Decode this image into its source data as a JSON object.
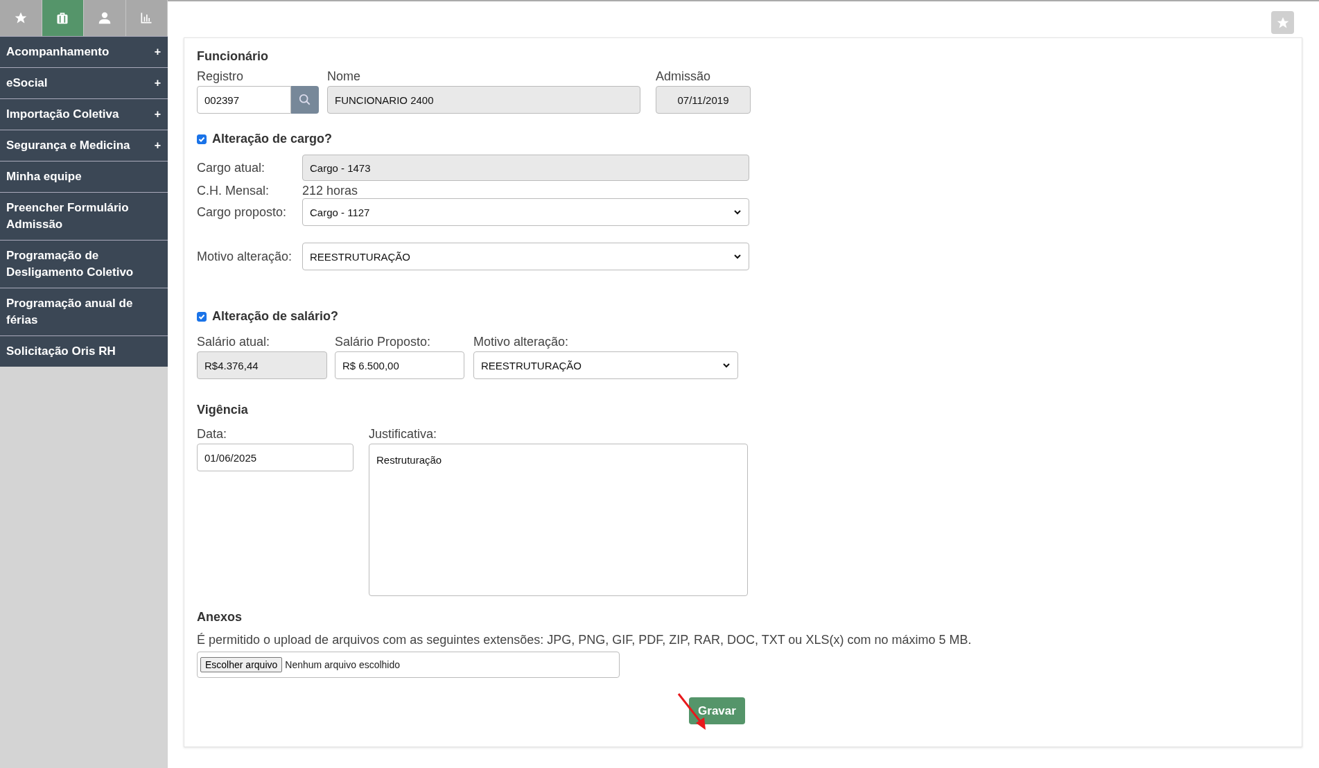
{
  "sidebar": {
    "tabs": [
      {
        "kind": "star",
        "selected": false
      },
      {
        "kind": "briefcase",
        "selected": true
      },
      {
        "kind": "person",
        "selected": false
      },
      {
        "kind": "chart",
        "selected": false
      }
    ],
    "menu": [
      {
        "label": "Acompanhamento",
        "toggle": "+"
      },
      {
        "label": "eSocial",
        "toggle": "+"
      },
      {
        "label": "Importação Coletiva",
        "toggle": "+"
      },
      {
        "label": "Segurança e Medicina",
        "toggle": "+"
      },
      {
        "label": "Minha equipe"
      },
      {
        "label": "Preencher Formulário Admissão"
      },
      {
        "label": "Programação de Desligamento Coletivo"
      },
      {
        "label": "Programação anual de férias"
      },
      {
        "label": "Solicitação Oris RH"
      }
    ]
  },
  "form": {
    "employee": {
      "title": "Funcionário",
      "registro": {
        "label": "Registro",
        "value": "002397"
      },
      "nome": {
        "label": "Nome",
        "value": "FUNCIONARIO 2400"
      },
      "admissao": {
        "label": "Admissão",
        "value": "07/11/2019"
      }
    },
    "cargo": {
      "label": "Alteração de cargo?",
      "checked": true,
      "atual": {
        "label": "Cargo atual:",
        "value": "Cargo - 1473"
      },
      "ch": {
        "label": "C.H. Mensal:",
        "value": "212 horas"
      },
      "proposto": {
        "label": "Cargo proposto:",
        "value": "Cargo - 1127"
      },
      "motivo": {
        "label": "Motivo alteração:",
        "value": "REESTRUTURAÇÃO"
      }
    },
    "salario": {
      "label": "Alteração de salário?",
      "checked": true,
      "atual": {
        "label": "Salário atual:",
        "value": "R$4.376,44"
      },
      "proposto": {
        "label": "Salário Proposto:",
        "value": "R$ 6.500,00"
      },
      "motivo": {
        "label": "Motivo alteração:",
        "value": "REESTRUTURAÇÃO"
      }
    },
    "vigencia": {
      "title": "Vigência",
      "data": {
        "label": "Data:",
        "value": "01/06/2025"
      },
      "justificativa": {
        "label": "Justificativa:",
        "value": "Restruturação"
      }
    },
    "anexos": {
      "title": "Anexos",
      "note": "É permitido o upload de arquivos com as seguintes extensões: JPG, PNG, GIF, PDF, ZIP, RAR, DOC, TXT ou XLS(x) com no máximo 5 MB.",
      "file_button": "Escolher arquivo",
      "file_status": "Nenhum arquivo escolhido"
    },
    "save_button": "Gravar"
  }
}
